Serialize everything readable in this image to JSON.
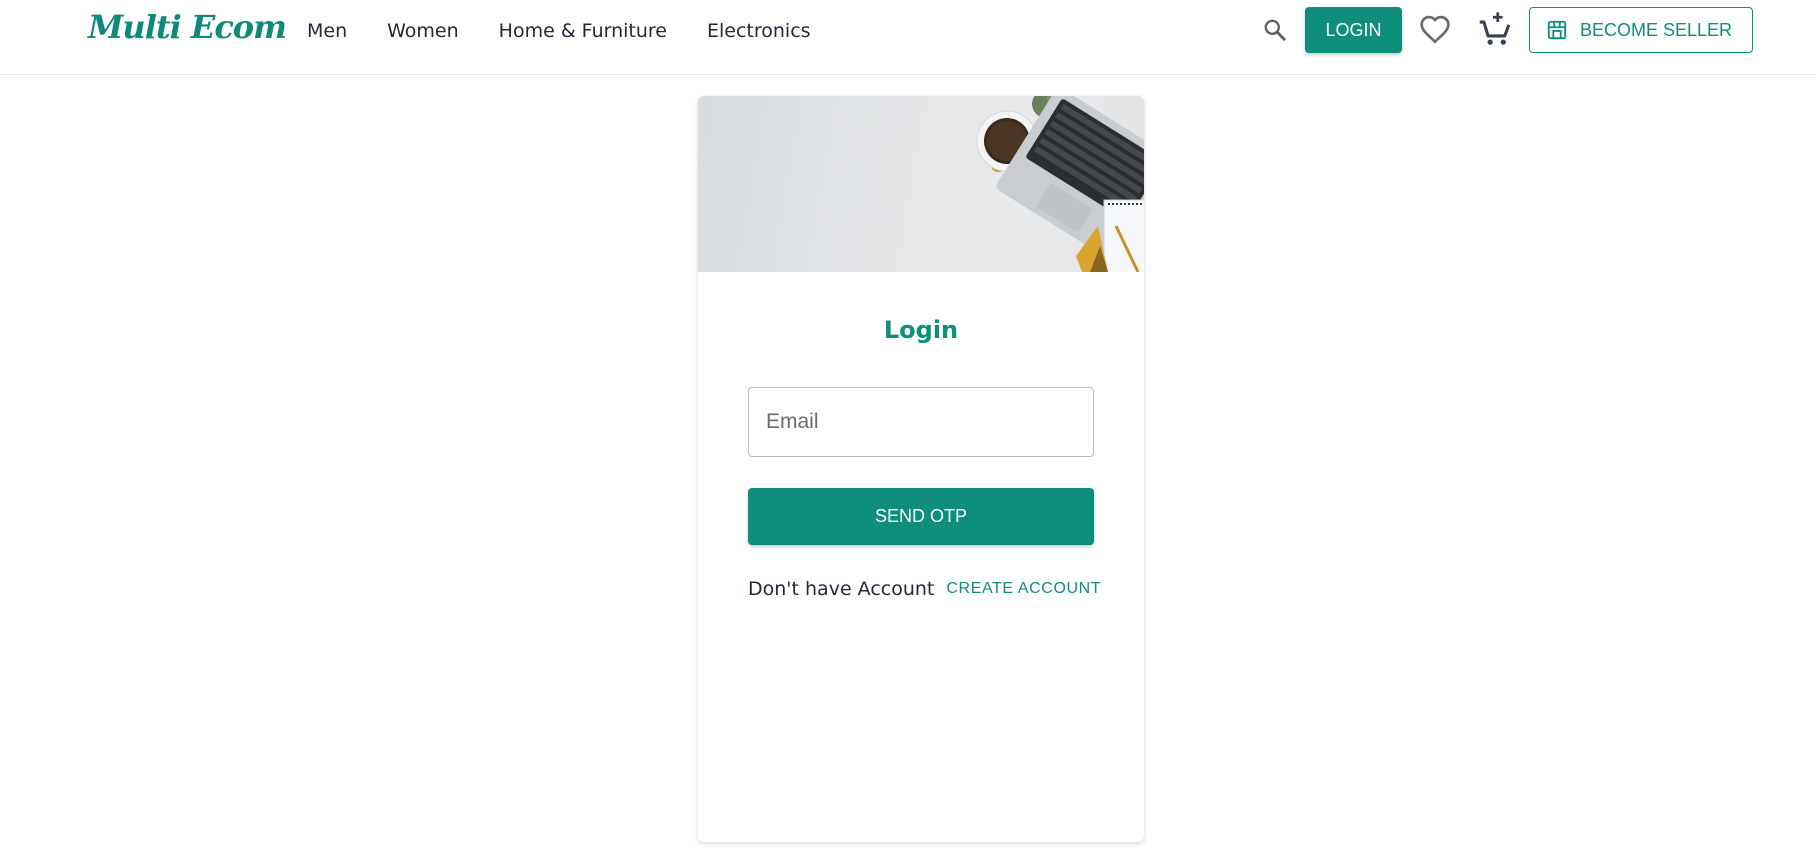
{
  "brand": {
    "logo_text": "Multi Ecom",
    "accent_color": "#0d8f7b"
  },
  "nav": {
    "links": [
      {
        "label": "Men"
      },
      {
        "label": "Women"
      },
      {
        "label": "Home & Furniture"
      },
      {
        "label": "Electronics"
      }
    ]
  },
  "header_actions": {
    "search_icon": "search-icon",
    "login_label": "LOGIN",
    "wishlist_icon": "heart-icon",
    "cart_icon": "add-shopping-cart-icon",
    "seller_icon": "storefront-icon",
    "seller_label": "BECOME SELLER"
  },
  "login_card": {
    "banner_image": "desk-flatlay-laptop-coffee",
    "title": "Login",
    "email_placeholder": "Email",
    "email_value": "",
    "submit_label": "SEND OTP",
    "no_account_text": "Don't have Account",
    "create_account_label": "CREATE ACCOUNT"
  }
}
